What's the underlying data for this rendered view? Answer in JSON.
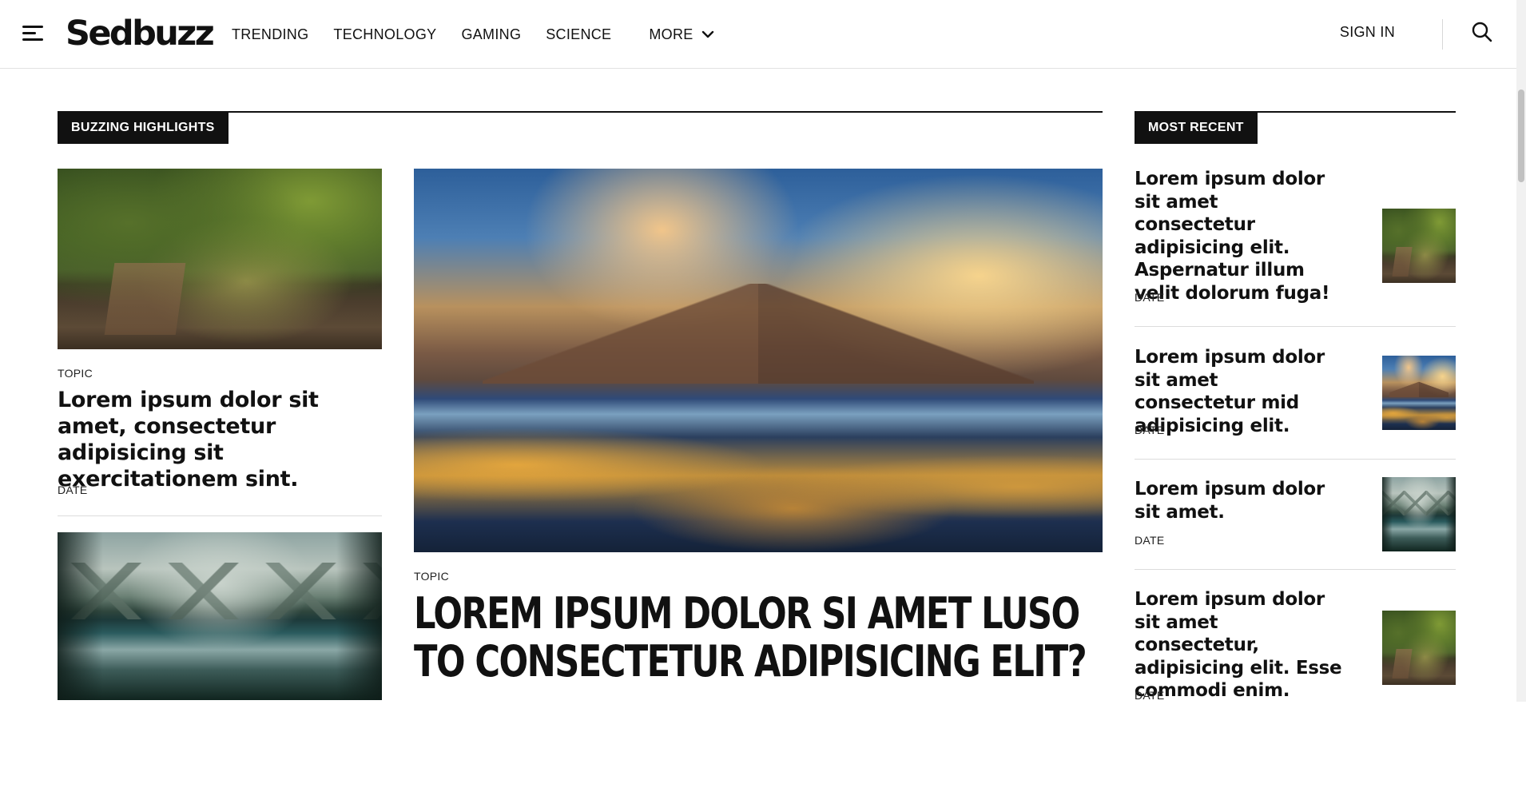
{
  "header": {
    "logo": "Sedbuzz",
    "nav": [
      "TRENDING",
      "TECHNOLOGY",
      "GAMING",
      "SCIENCE"
    ],
    "more_label": "MORE",
    "sign_in": "SIGN IN",
    "icons": {
      "menu": "hamburger-menu-icon",
      "more": "chevron-down-icon",
      "search": "search-icon"
    }
  },
  "highlights": {
    "label": "BUZZING  HIGHLIGHTS",
    "left_card": {
      "topic": "TOPIC",
      "title": "Lorem ipsum dolor sit amet, consectetur adipisicing sit exercitationem sint.",
      "date": "DATE"
    },
    "feature": {
      "topic": "TOPIC",
      "title": "LOREM IPSUM DOLOR SI AMET LUSO TO CONSECTETUR ADIPISICING ELIT?"
    }
  },
  "recent": {
    "label": "MOST  RECENT",
    "items": [
      {
        "title": "Lorem ipsum dolor sit amet consectetur adipisicing elit. Aspernatur illum velit dolorum fuga!",
        "date": "DATE"
      },
      {
        "title": "Lorem ipsum dolor sit amet consectetur mid adipisicing elit.",
        "date": "DATE"
      },
      {
        "title": "Lorem ipsum dolor sit amet.",
        "date": "DATE"
      },
      {
        "title": "Lorem ipsum dolor sit amet consectetur, adipisicing elit. Esse commodi enim.",
        "date": "DATE"
      }
    ]
  }
}
